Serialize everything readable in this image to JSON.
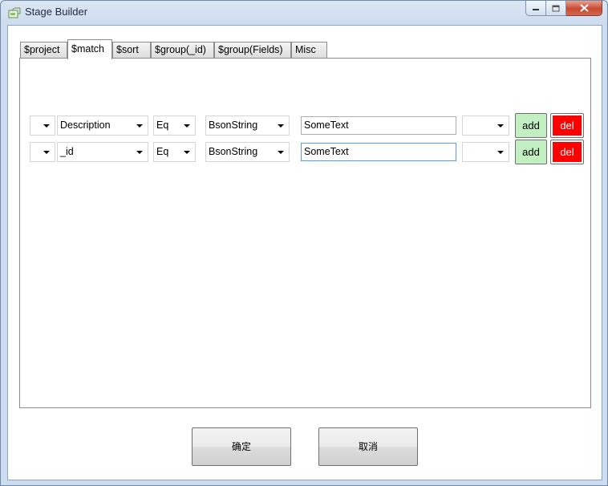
{
  "window": {
    "title": "Stage Builder",
    "icon": "app-icon"
  },
  "tabs": [
    {
      "label": "$project",
      "active": false
    },
    {
      "label": "$match",
      "active": true
    },
    {
      "label": "$sort",
      "active": false
    },
    {
      "label": "$group(_id)",
      "active": false
    },
    {
      "label": "$group(Fields)",
      "active": false
    },
    {
      "label": "Misc",
      "active": false
    }
  ],
  "match_rows": [
    {
      "prefix": "",
      "field": "Description",
      "operator": "Eq",
      "type": "BsonString",
      "value": "SomeText",
      "logic": "",
      "add_label": "add",
      "del_label": "del"
    },
    {
      "prefix": "",
      "field": "_id",
      "operator": "Eq",
      "type": "BsonString",
      "value": "SomeText",
      "logic": "",
      "add_label": "add",
      "del_label": "del"
    }
  ],
  "dialog": {
    "ok_label": "确定",
    "cancel_label": "取消"
  },
  "colors": {
    "add_button": "#c2f0c2",
    "del_button": "#ff0000",
    "focus_border": "#569de5"
  }
}
